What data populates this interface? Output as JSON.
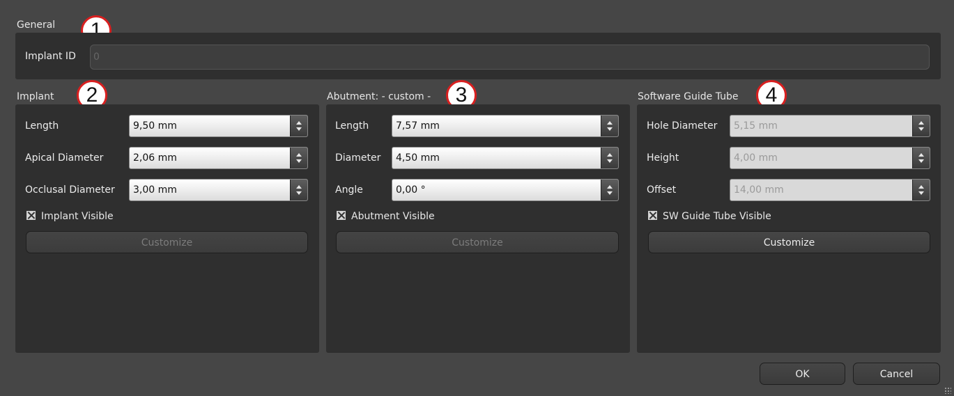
{
  "general": {
    "title": "General",
    "badge": "1",
    "implant_id_label": "Implant ID",
    "implant_id_value": "0"
  },
  "implant": {
    "title": "Implant",
    "badge": "2",
    "length_label": "Length",
    "length_value": "9,50 mm",
    "apical_label": "Apical Diameter",
    "apical_value": "2,06 mm",
    "occlusal_label": "Occlusal Diameter",
    "occlusal_value": "3,00 mm",
    "visible_label": "Implant Visible",
    "visible_checked": true,
    "customize_label": "Customize"
  },
  "abutment": {
    "title": "Abutment: - custom -",
    "badge": "3",
    "length_label": "Length",
    "length_value": "7,57 mm",
    "diameter_label": "Diameter",
    "diameter_value": "4,50 mm",
    "angle_label": "Angle",
    "angle_value": "0,00 °",
    "visible_label": "Abutment Visible",
    "visible_checked": true,
    "customize_label": "Customize"
  },
  "guide_tube": {
    "title": "Software Guide Tube",
    "badge": "4",
    "hole_label": "Hole Diameter",
    "hole_value": "5,15 mm",
    "height_label": "Height",
    "height_value": "4,00 mm",
    "offset_label": "Offset",
    "offset_value": "14,00 mm",
    "visible_label": "SW Guide Tube Visible",
    "visible_checked": true,
    "customize_label": "Customize"
  },
  "footer": {
    "ok_label": "OK",
    "cancel_label": "Cancel"
  }
}
